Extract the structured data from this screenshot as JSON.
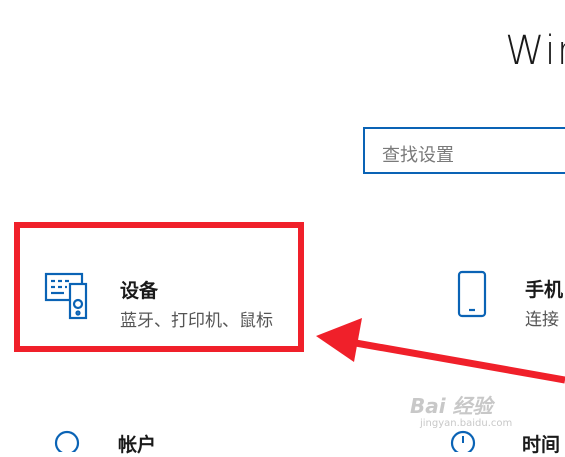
{
  "window": {
    "title": "Win"
  },
  "search": {
    "placeholder": "查找设置"
  },
  "tiles": [
    {
      "name": "设备",
      "desc": "蓝牙、打印机、鼠标",
      "icon": "devices-icon"
    },
    {
      "name": "手机",
      "desc": "连接",
      "icon": "phone-icon"
    },
    {
      "name": "帐户",
      "icon": "account-icon"
    },
    {
      "name": "时间",
      "icon": "time-icon"
    }
  ],
  "annotation": {
    "highlight_color": "#f0202a",
    "arrow_color": "#f0202a"
  },
  "watermark": {
    "text": "Bai 经验",
    "sub": "jingyan.baidu.com"
  },
  "colors": {
    "accent": "#0a63b5"
  }
}
